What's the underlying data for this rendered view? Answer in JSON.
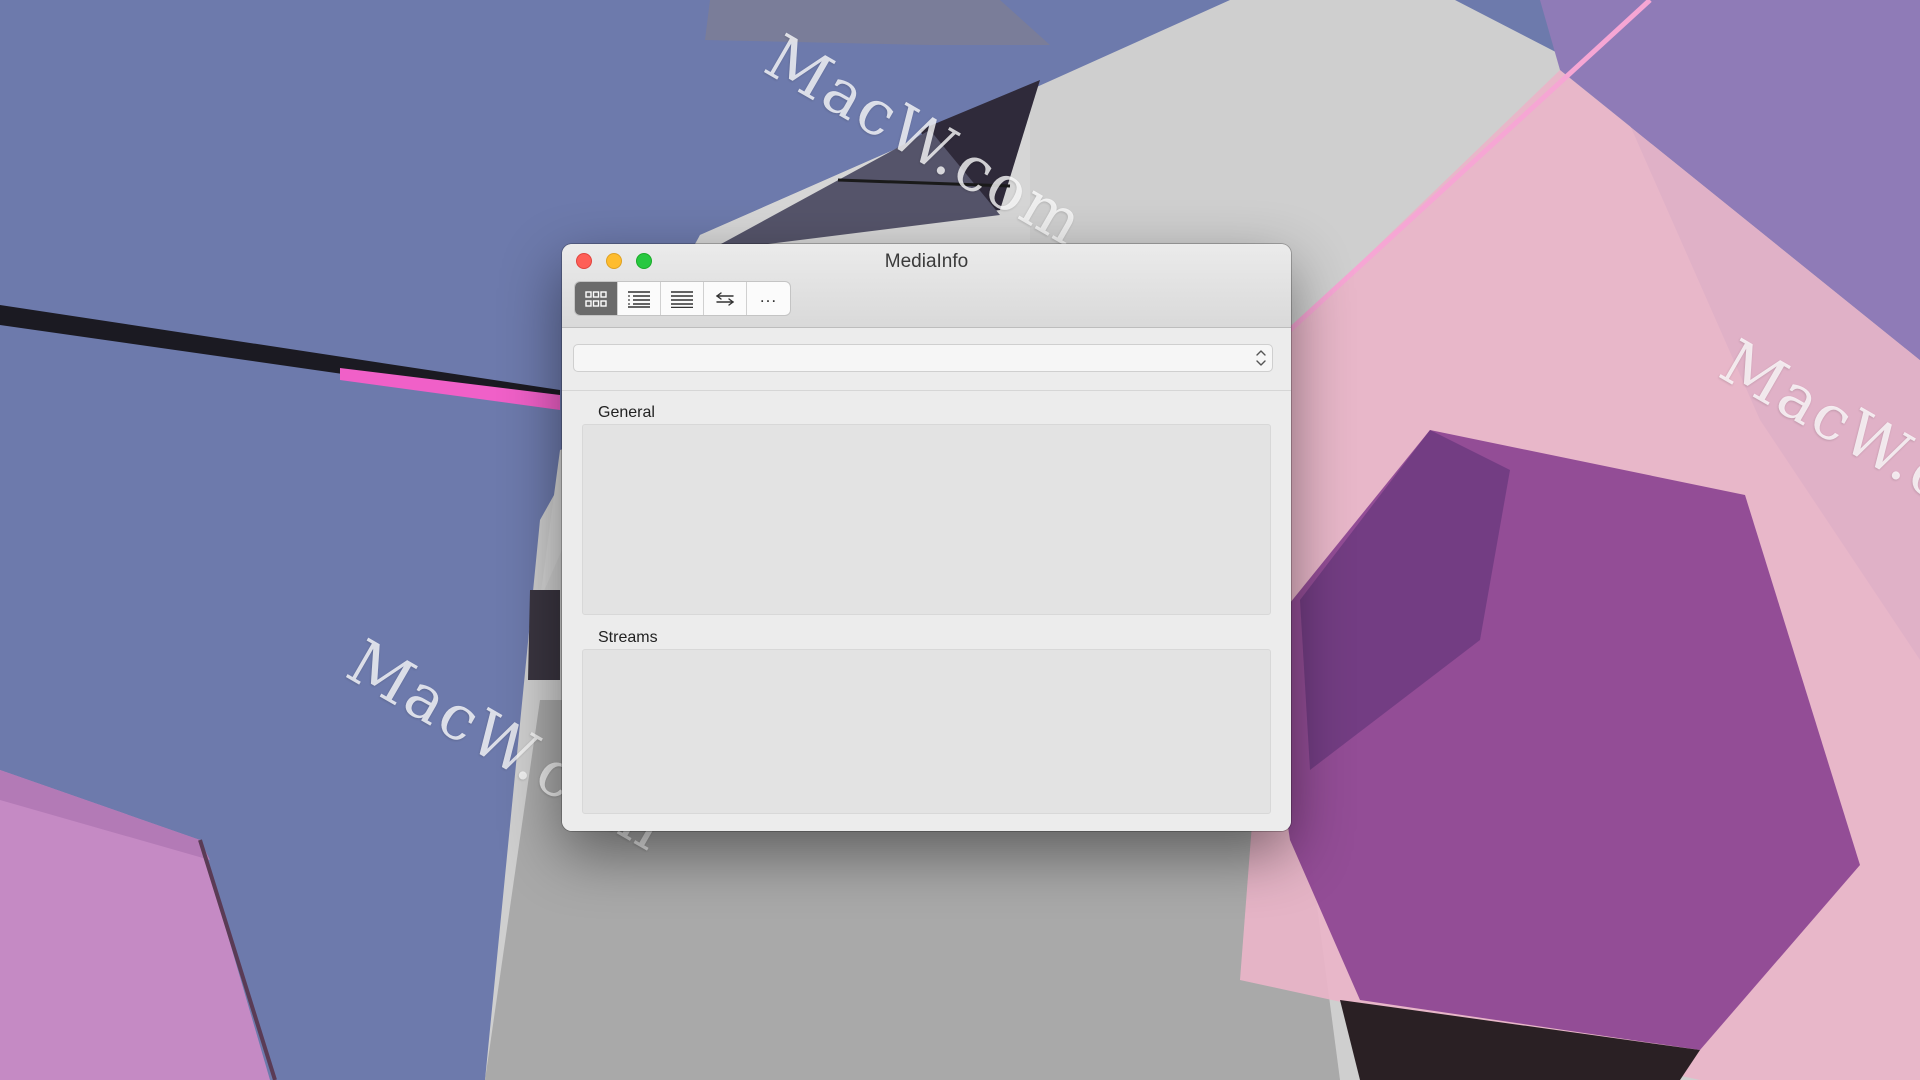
{
  "window": {
    "title": "MediaInfo"
  },
  "toolbar": {
    "buttons": [
      {
        "name": "easy-view",
        "icon": "grid-icon",
        "selected": true
      },
      {
        "name": "sheet-view",
        "icon": "indented-list-icon",
        "selected": false
      },
      {
        "name": "text-view",
        "icon": "text-lines-icon",
        "selected": false
      },
      {
        "name": "compare-view",
        "icon": "swap-arrows-icon",
        "selected": false
      },
      {
        "name": "more",
        "icon": "more-icon",
        "label": "...",
        "selected": false
      }
    ]
  },
  "file_selector": {
    "value": "",
    "icon": "up-down-chevron-icon"
  },
  "sections": {
    "general": {
      "label": "General"
    },
    "streams": {
      "label": "Streams"
    }
  },
  "desktop": {
    "watermark_text": "MacW.com",
    "watermarks": [
      "MacW.com",
      "MacW.com",
      "MacW.com"
    ]
  },
  "colors": {
    "close": "#fe5f57",
    "minimize": "#febc2e",
    "zoom": "#28c840",
    "toolbar_selected": "#6b6b6b",
    "wallpaper_blue": "#6d7aac",
    "wallpaper_pink": "#eab4c8",
    "wallpaper_purple": "#8b4a92"
  }
}
